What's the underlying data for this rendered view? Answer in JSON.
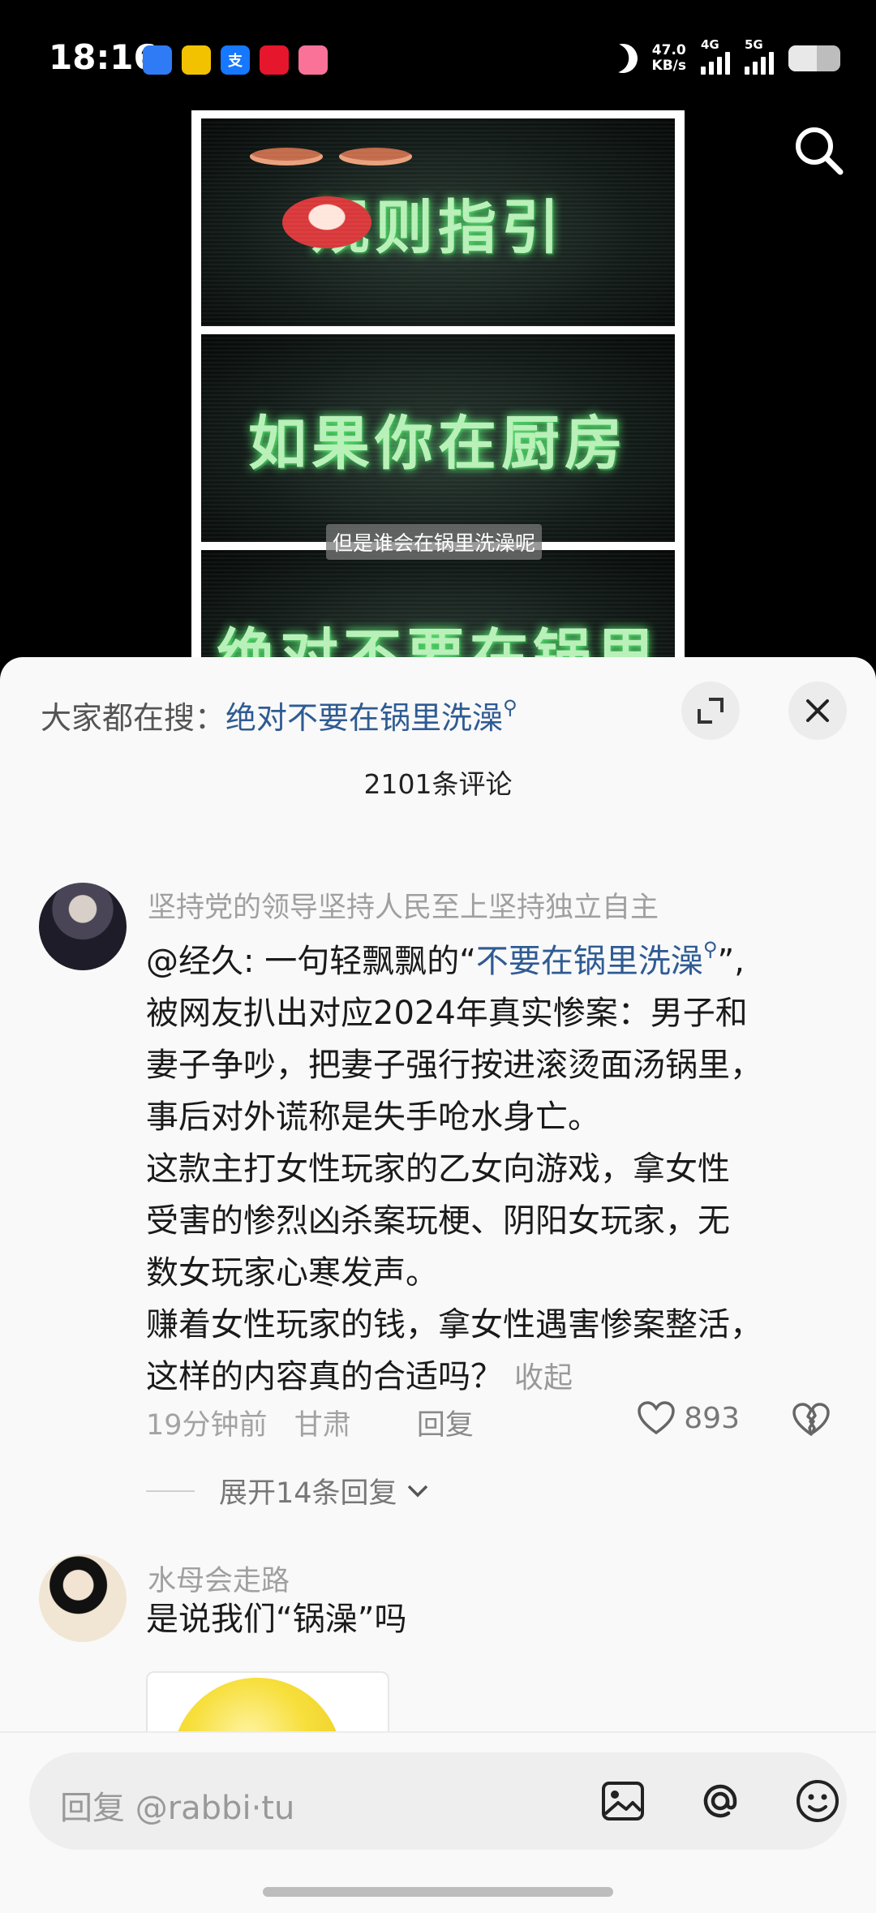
{
  "status_bar": {
    "time": "18:16",
    "app_icons": [
      {
        "name": "app-icon-blue",
        "glyph": "",
        "color": "#2f7bf5"
      },
      {
        "name": "app-icon-yellow",
        "glyph": "",
        "color": "#f2c200"
      },
      {
        "name": "alipay-icon",
        "glyph": "支",
        "color": "#1677ff"
      },
      {
        "name": "weibo-icon",
        "glyph": "",
        "color": "#e6162d"
      },
      {
        "name": "bilibili-icon",
        "glyph": "",
        "color": "#fb7299"
      }
    ],
    "net_speed_value": "47.0",
    "net_speed_unit": "KB/s",
    "signal1_label": "4G",
    "signal2_label": "5G"
  },
  "video": {
    "panel1_text": "规则指引",
    "panel2_text": "如果你在厨房",
    "panel3_text": "绝对不要在锅里洗澡",
    "subtitle": "但是谁会在锅里洗澡呢"
  },
  "sheet": {
    "hot_search_prefix": "大家都在搜：",
    "hot_search_keyword": "绝对不要在锅里洗澡",
    "comment_count": "2101条评论"
  },
  "comments": [
    {
      "username": "坚持党的领导坚持人民至上坚持独立自主",
      "line1_prefix": "@经久: 一句轻飘飘的“",
      "line1_keyword": "不要在锅里洗澡",
      "line1_suffix": "”,",
      "lines": [
        "被网友扒出对应2024年真实惨案：男子和",
        "妻子争吵，把妻子强行按进滚烫面汤锅里，",
        "事后对外谎称是失手呛水身亡。",
        "这款主打女性玩家的乙女向游戏，拿女性",
        "受害的惨烈凶杀案玩梗、阴阳女玩家，无",
        "数女玩家心寒发声。",
        "赚着女性玩家的钱，拿女性遇害惨案整活，"
      ],
      "last_line": "这样的内容真的合适吗？",
      "collapse_label": "收起",
      "time": "19分钟前",
      "location": "甘肃",
      "reply_label": "回复",
      "likes": "893",
      "expand_replies": "展开14条回复"
    },
    {
      "username": "水母会走路",
      "text": "是说我们“锅澡”吗"
    }
  ],
  "input_bar": {
    "placeholder": "回复 @rabbi·tu"
  }
}
